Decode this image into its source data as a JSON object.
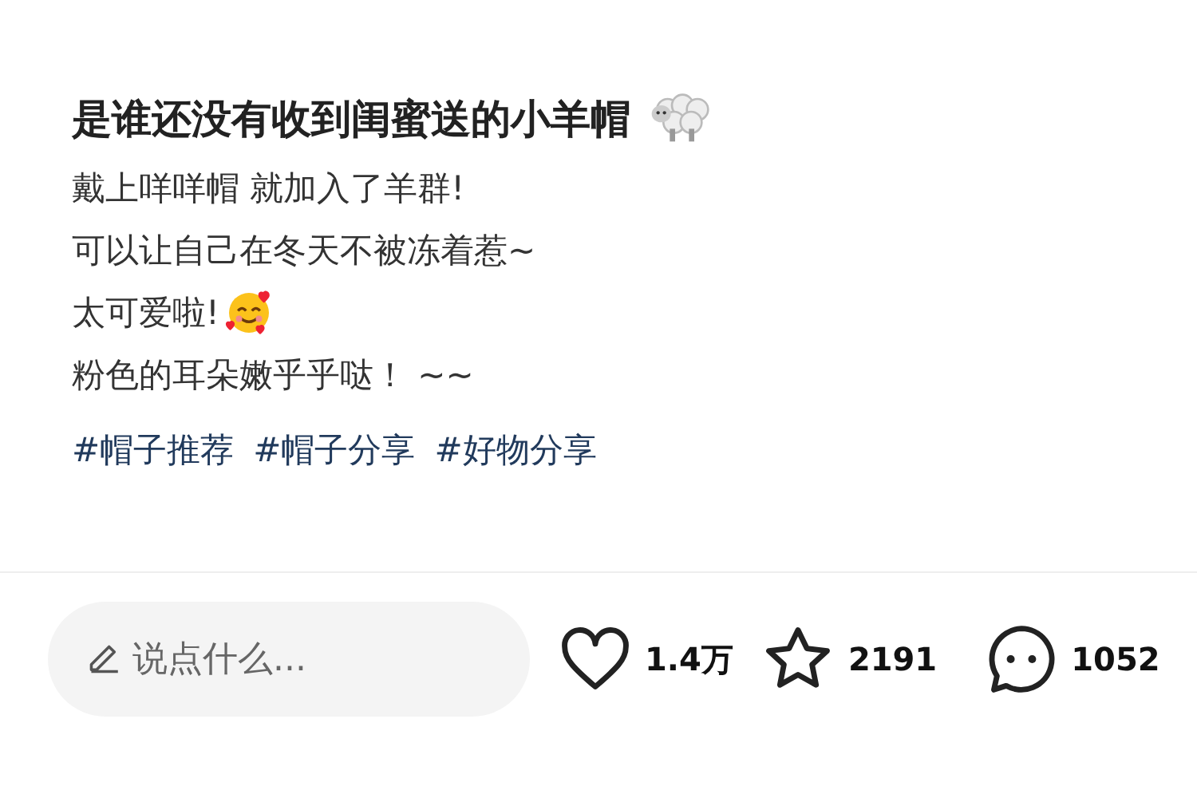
{
  "post": {
    "title": {
      "text": "是谁还没有收到闺蜜送的小羊帽",
      "kind": "sheep"
    },
    "lines": [
      {
        "text": "戴上咩咩帽 就加入了羊群!",
        "kind": "plain"
      },
      {
        "text": "可以让自己在冬天不被冻着惹~",
        "kind": "plain"
      },
      {
        "text": "太可爱啦!",
        "kind": "smiley"
      },
      {
        "text": "粉色的耳朵嫩乎乎哒！ ~~",
        "kind": "plain"
      }
    ],
    "tags": [
      "#帽子推荐",
      "#帽子分享",
      "#好物分享"
    ]
  },
  "action_bar": {
    "comment_field": {
      "placeholder": "说点什么..."
    },
    "actions": [
      {
        "kind": "like",
        "count": "1.4万"
      },
      {
        "kind": "favorite",
        "count": "2191"
      },
      {
        "kind": "comment",
        "count": "1052"
      }
    ]
  }
}
